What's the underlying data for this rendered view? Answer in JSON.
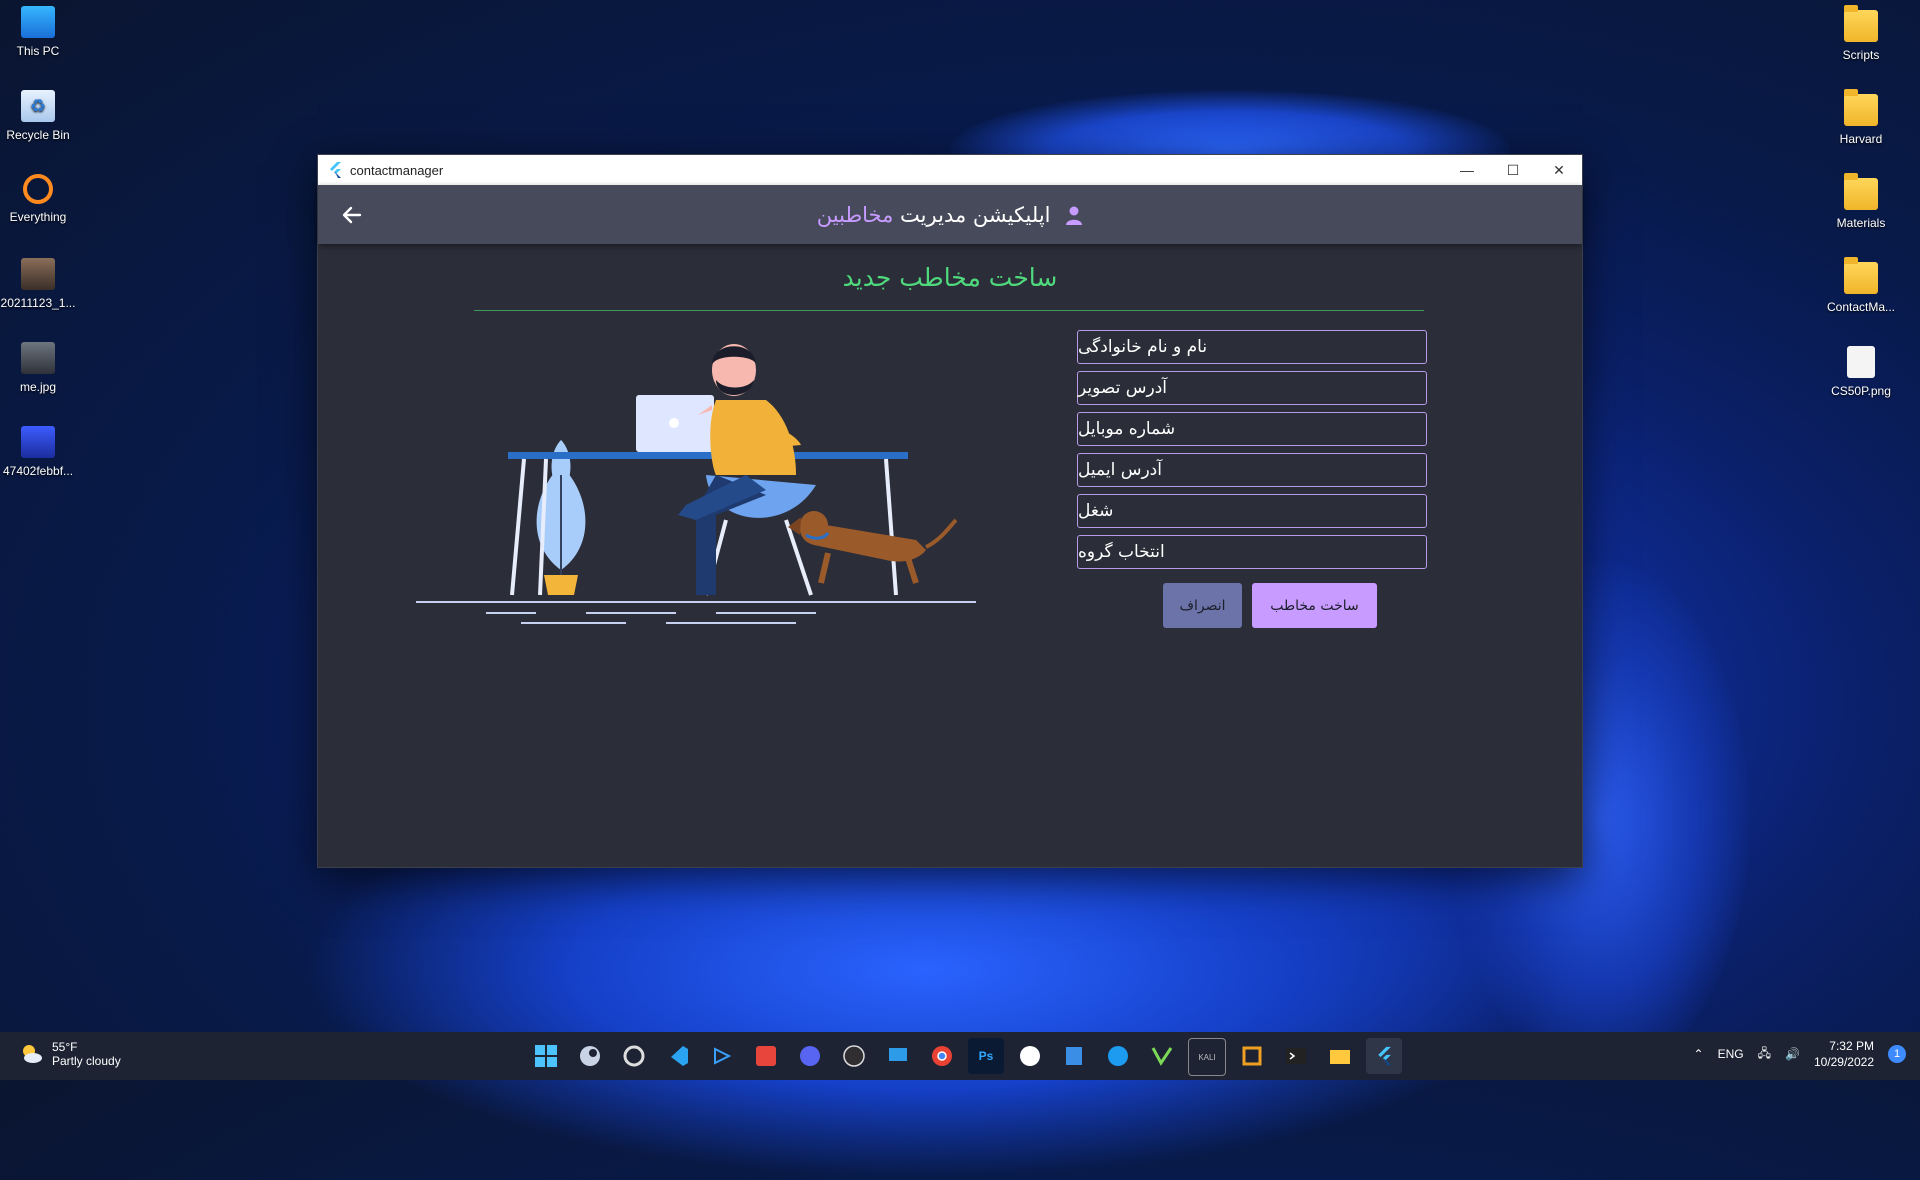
{
  "desktop": {
    "left_icons": [
      {
        "label": "This PC",
        "icon": "monitor-icon"
      },
      {
        "label": "Recycle Bin",
        "icon": "recycle-bin-icon"
      },
      {
        "label": "Everything",
        "icon": "search-app-icon"
      },
      {
        "label": "20211123_1...",
        "icon": "photo-icon"
      },
      {
        "label": "me.jpg",
        "icon": "photo-icon"
      },
      {
        "label": "47402febbf...",
        "icon": "image-file-icon"
      }
    ],
    "right_icons": [
      {
        "label": "Scripts",
        "icon": "folder-icon"
      },
      {
        "label": "Harvard",
        "icon": "folder-icon"
      },
      {
        "label": "Materials",
        "icon": "folder-icon"
      },
      {
        "label": "ContactMa...",
        "icon": "folder-icon"
      },
      {
        "label": "CS50P.png",
        "icon": "png-file-icon"
      }
    ]
  },
  "window": {
    "title": "contactmanager",
    "controls": {
      "minimize": "—",
      "maximize": "☐",
      "close": "✕"
    }
  },
  "appbar": {
    "title_main": "اپلیکیشن مدیریت",
    "title_accent": "مخاطبین",
    "back_icon": "arrow-left-icon"
  },
  "page": {
    "title": "ساخت مخاطب جدید"
  },
  "form": {
    "fields": [
      {
        "placeholder": "نام و نام خانوادگی"
      },
      {
        "placeholder": "آدرس تصویر"
      },
      {
        "placeholder": "شماره موبایل"
      },
      {
        "placeholder": "آدرس ایمیل"
      },
      {
        "placeholder": "شغل"
      },
      {
        "placeholder": "انتخاب گروه"
      }
    ],
    "create_button": "ساخت مخاطب",
    "cancel_button": "انصراف"
  },
  "colors": {
    "accent_purple": "#c79bff",
    "title_green": "#4fd97c",
    "cancel_button": "#6b73a8",
    "window_bg": "#2b2d38",
    "appbar_bg": "#474a5a"
  },
  "taskbar": {
    "weather": {
      "temp": "55°F",
      "condition": "Partly cloudy"
    },
    "apps": [
      "windows-start-icon",
      "steam-icon",
      "obs-ring-icon",
      "vscode-icon",
      "code-editor-icon",
      "git-client-icon",
      "discord-icon",
      "obs-icon",
      "monitor-app-icon",
      "chrome-icon",
      "photoshop-icon",
      "cloud-app-icon",
      "app-tile-icon",
      "docker-icon",
      "visual-studio-icon",
      "kali-icon",
      "virtualbox-icon",
      "terminal-icon",
      "file-explorer-icon",
      "flutter-icon"
    ],
    "photoshop_label": "Ps",
    "kali_label": "KALI",
    "language": "ENG",
    "time": "7:32 PM",
    "date": "10/29/2022",
    "notifications": "1"
  }
}
